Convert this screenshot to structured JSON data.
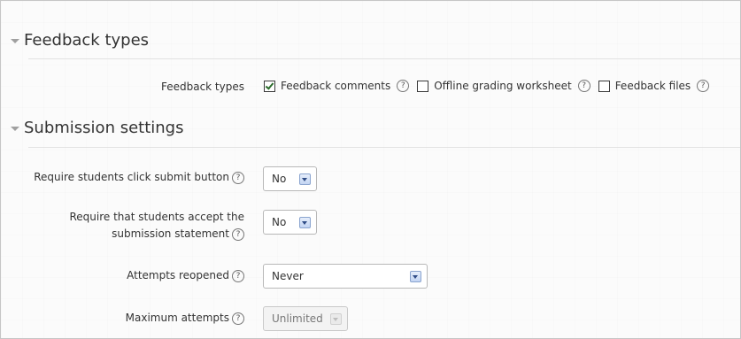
{
  "sections": {
    "feedback": {
      "title": "Feedback types",
      "field_label": "Feedback types",
      "options": [
        {
          "label": "Feedback comments",
          "checked": true
        },
        {
          "label": "Offline grading worksheet",
          "checked": false
        },
        {
          "label": "Feedback files",
          "checked": false
        }
      ]
    },
    "submission": {
      "title": "Submission settings",
      "fields": {
        "require_submit": {
          "label": "Require students click submit button",
          "value": "No"
        },
        "accept_statement": {
          "label_line1": "Require that students accept the",
          "label_line2": "submission statement",
          "value": "No"
        },
        "attempts_reopened": {
          "label": "Attempts reopened",
          "value": "Never"
        },
        "max_attempts": {
          "label": "Maximum attempts",
          "value": "Unlimited",
          "disabled": true
        }
      }
    }
  },
  "help_glyph": "?",
  "icons": {
    "help": "help-icon",
    "collapse": "caret-down-icon",
    "dropdown": "chevron-down-icon"
  },
  "colors": {
    "checkmark": "#2a6b2a",
    "select_arrow": "#2f4c86",
    "text": "#333333"
  }
}
